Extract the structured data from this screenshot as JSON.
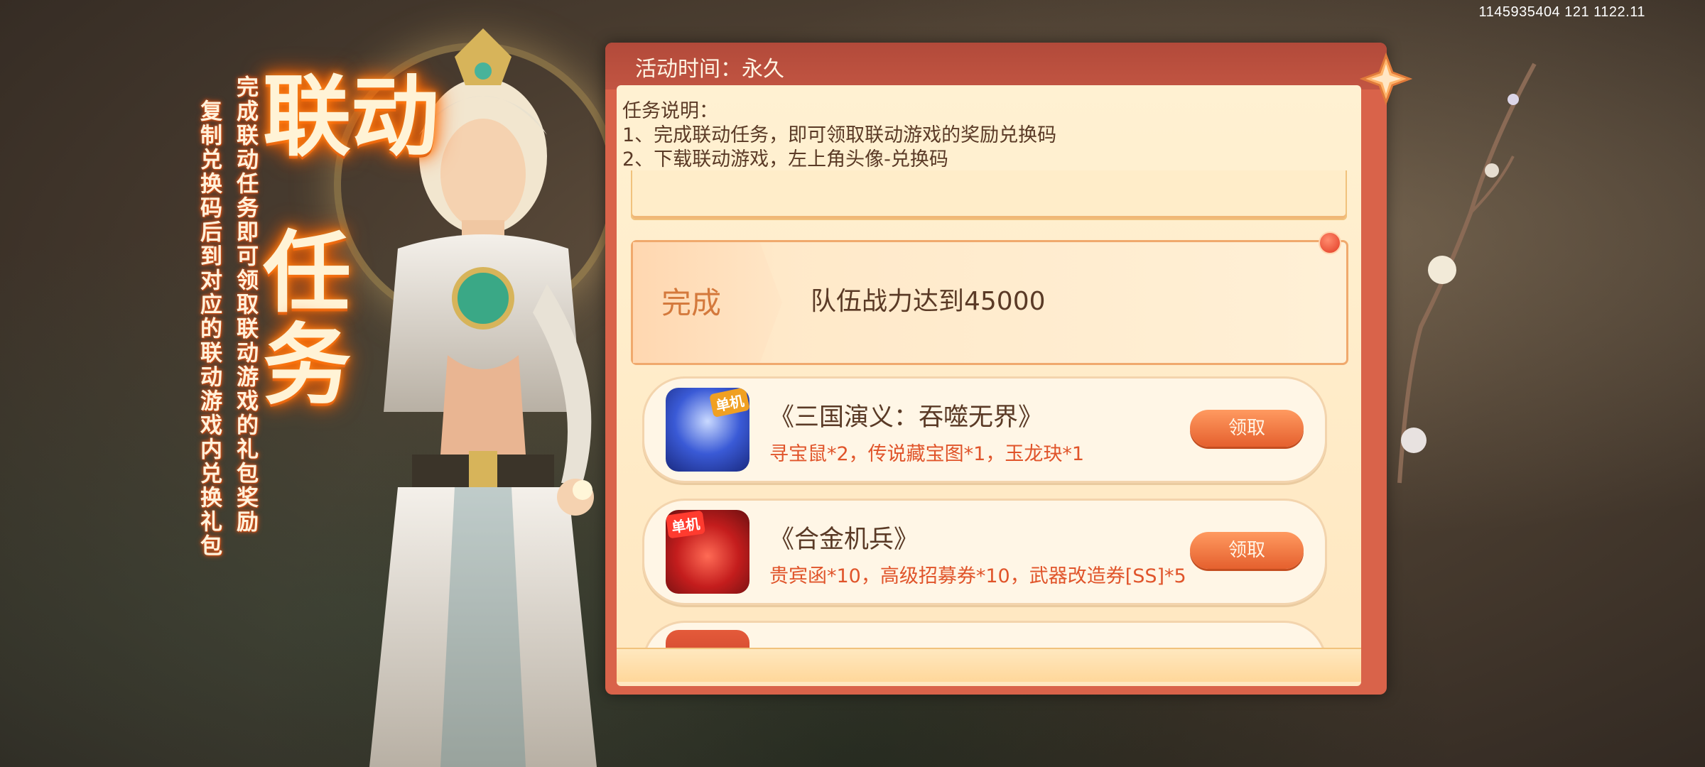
{
  "status_bar": {
    "text": "1145935404 121 1122.11"
  },
  "title": {
    "line1": "联动",
    "line2": "任务"
  },
  "vertical_notes": {
    "line1": "完成联动任务即可领取联动游戏的礼包奖励",
    "line2": "复制兑换码后到对应的联动游戏内兑换礼包"
  },
  "panel": {
    "time_label": "活动时间：永久",
    "description": {
      "heading": "任务说明：",
      "item1": "1、完成联动任务，即可领取联动游戏的奖励兑换码",
      "item2": "2、下载联动游戏，左上角头像-兑换码"
    },
    "task": {
      "status": "完成",
      "text": "队伍战力达到45000"
    },
    "rewards": [
      {
        "game": "《三国演义：吞噬无界》",
        "items": "寻宝鼠*2，传说藏宝图*1，玉龙玦*1",
        "button": "领取",
        "icon_badge": "单机"
      },
      {
        "game": "《合金机兵》",
        "items": "贵宾函*10，高级招募券*10，武器改造券[SS]*5",
        "button": "领取",
        "icon_badge": "单机"
      }
    ]
  },
  "colors": {
    "panel_border": "#d9634a",
    "panel_bg": "#fff1d2",
    "claim_button": "#e5602e",
    "reward_text": "#e0542a",
    "title_glow": "#ff6a00"
  },
  "icons": [
    "close-icon",
    "red-dot-notification",
    "game-icon-sanguo",
    "game-icon-hejin"
  ]
}
